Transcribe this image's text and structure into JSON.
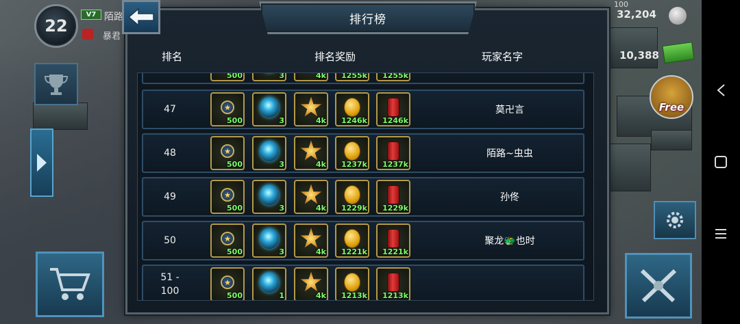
{
  "hud": {
    "level": "22",
    "vip": "V7",
    "player_name": "陌路",
    "clan_name": "暴君",
    "top_counter": "100",
    "resource_silver": "32,204",
    "resource_cash": "10,388",
    "free_label": "Free"
  },
  "panel": {
    "title": "排行榜",
    "headers": {
      "rank": "排名",
      "rewards": "排名奖励",
      "player": "玩家名字"
    }
  },
  "rows": [
    {
      "rank": "",
      "player": "",
      "rewards": [
        "500",
        "3",
        "4k",
        "1255k",
        "1255k"
      ]
    },
    {
      "rank": "47",
      "player": "莫卍言",
      "rewards": [
        "500",
        "3",
        "4k",
        "1246k",
        "1246k"
      ]
    },
    {
      "rank": "48",
      "player": "陌路~虫虫",
      "rewards": [
        "500",
        "3",
        "4k",
        "1237k",
        "1237k"
      ]
    },
    {
      "rank": "49",
      "player": "孙佟",
      "rewards": [
        "500",
        "3",
        "4k",
        "1229k",
        "1229k"
      ]
    },
    {
      "rank": "50",
      "player": "聚龙🐲也时",
      "rewards": [
        "500",
        "3",
        "4k",
        "1221k",
        "1221k"
      ]
    },
    {
      "rank": "51 -\n100",
      "player": "",
      "rewards": [
        "500",
        "1",
        "4k",
        "1213k",
        "1213k"
      ]
    }
  ],
  "reward_icons": [
    "star-medal-icon",
    "energy-orb-icon",
    "gold-star-medal-icon",
    "gold-coin-icon",
    "fuel-canister-icon"
  ]
}
